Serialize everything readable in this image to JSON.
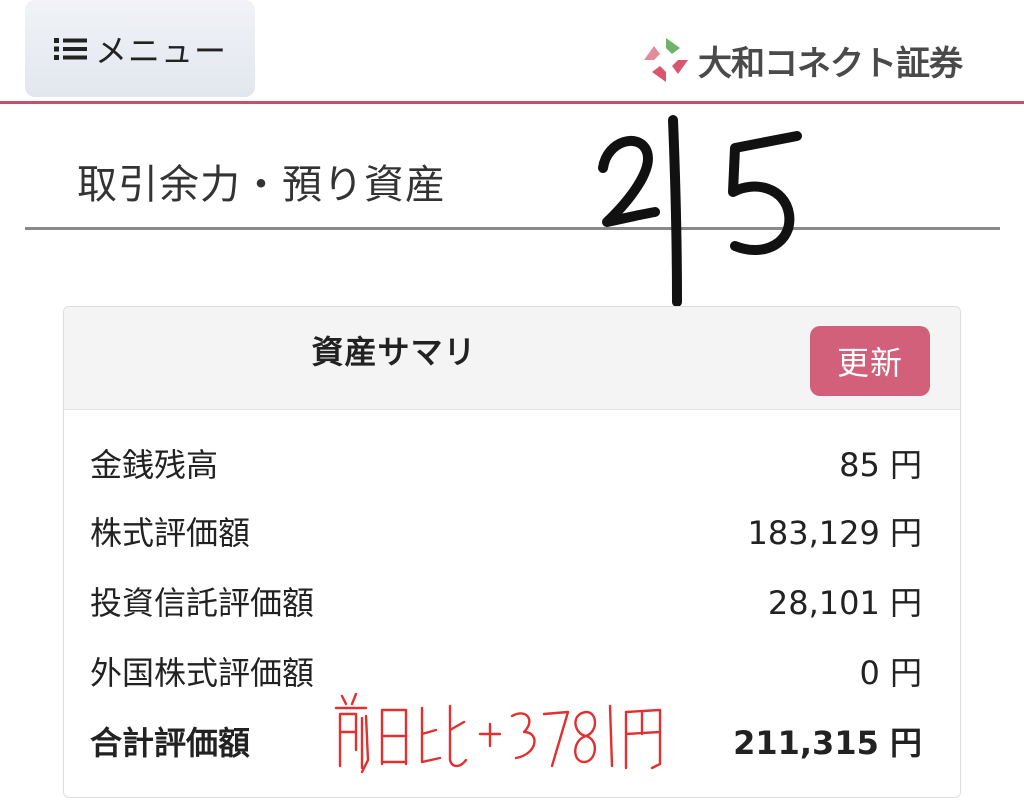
{
  "header": {
    "menu_label": "メニュー",
    "brand_name": "大和コネクト証券",
    "accent_color": "#c55068"
  },
  "page": {
    "title": "取引余力・預り資産"
  },
  "annotations": {
    "date_handwritten": "2/5",
    "note_handwritten": "前日比+3781円"
  },
  "summary": {
    "title": "資産サマリ",
    "refresh_label": "更新",
    "rows": [
      {
        "label": "金銭残高",
        "value": "85 円"
      },
      {
        "label": "株式評価額",
        "value": "183,129 円"
      },
      {
        "label": "投資信託評価額",
        "value": "28,101 円"
      },
      {
        "label": "外国株式評価額",
        "value": "0 円"
      },
      {
        "label": "合計評価額",
        "value": "211,315 円"
      }
    ]
  },
  "icons": {
    "menu": "list-icon",
    "logo": "daiwa-logo-icon"
  }
}
